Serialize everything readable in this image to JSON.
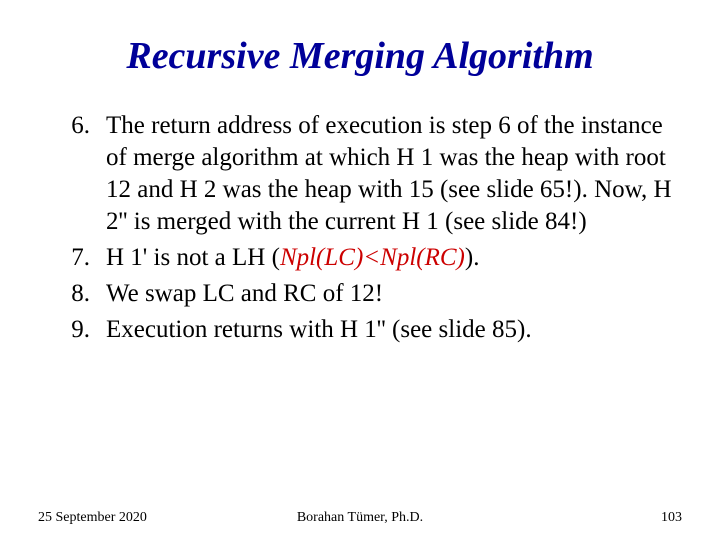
{
  "title": "Recursive Merging Algorithm",
  "items": [
    {
      "num": "6.",
      "text": "The return address of execution is step 6 of the instance of merge algorithm at which H 1 was the heap with root 12 and H 2 was the heap with 15 (see slide 65!).  Now, H 2'' is merged with the current H 1 (see slide 84!)"
    },
    {
      "num": "7.",
      "prefix": "H 1' is not a LH (",
      "formula": "Npl(LC)<Npl(RC)",
      "suffix": ")."
    },
    {
      "num": "8.",
      "text": "We swap LC and RC of 12!"
    },
    {
      "num": "9.",
      "text": "Execution returns with H 1'' (see slide 85)."
    }
  ],
  "footer": {
    "date": "25 September 2020",
    "author": "Borahan Tümer, Ph.D.",
    "page": "103"
  }
}
